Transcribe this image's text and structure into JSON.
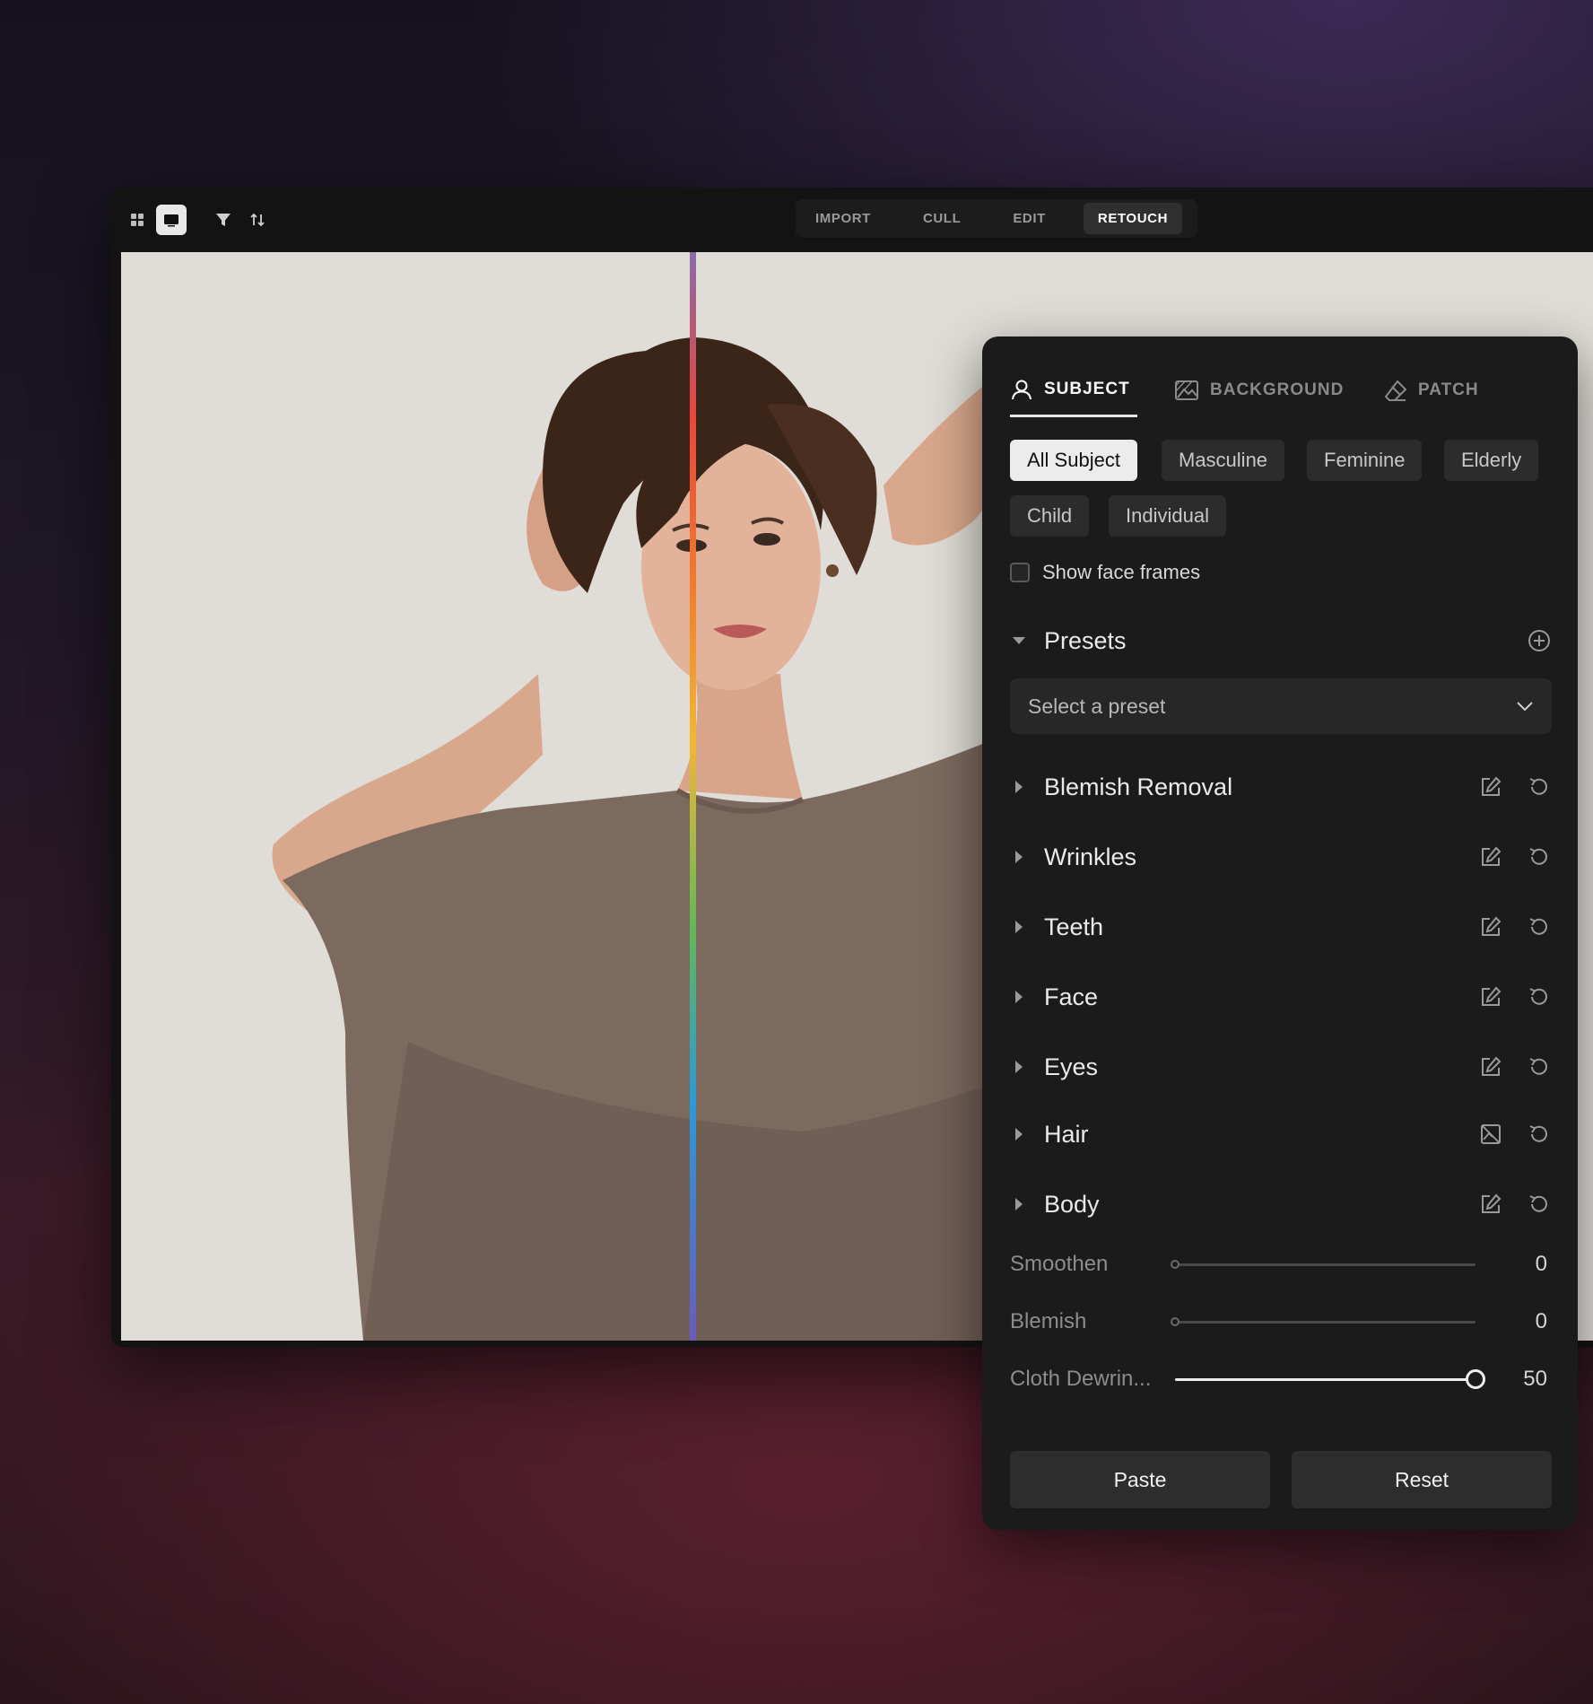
{
  "toolbar": {
    "modes": [
      "IMPORT",
      "CULL",
      "EDIT",
      "RETOUCH"
    ],
    "active_mode": "RETOUCH"
  },
  "panel": {
    "tabs": [
      "SUBJECT",
      "BACKGROUND",
      "PATCH"
    ],
    "active_tab": "SUBJECT",
    "chips": [
      "All Subject",
      "Masculine",
      "Feminine",
      "Elderly",
      "Child",
      "Individual"
    ],
    "active_chip": "All Subject",
    "show_face_frames": {
      "label": "Show face frames",
      "checked": false
    },
    "presets": {
      "title": "Presets",
      "placeholder": "Select a preset"
    },
    "sections": [
      "Blemish Removal",
      "Wrinkles",
      "Teeth",
      "Face",
      "Eyes",
      "Hair",
      "Body"
    ],
    "sliders": [
      {
        "label": "Smoothen",
        "value": "0",
        "fraction": 0.0
      },
      {
        "label": "Blemish",
        "value": "0",
        "fraction": 0.0
      },
      {
        "label": "Cloth Dewrin...",
        "value": "50",
        "fraction": 1.0
      }
    ],
    "buttons": {
      "paste": "Paste",
      "reset": "Reset"
    }
  },
  "colors": {
    "panel_bg": "#1b1b1b",
    "chip_active": "#ececec",
    "accent_line": "rainbow"
  },
  "icons": [
    "grid-icon",
    "single-view-icon",
    "filter-icon",
    "sort-icon",
    "person-icon",
    "image-icon",
    "eraser-icon",
    "plus-circle-icon",
    "chevron-down-icon",
    "caret-right-icon",
    "edit-icon",
    "undo-icon"
  ]
}
